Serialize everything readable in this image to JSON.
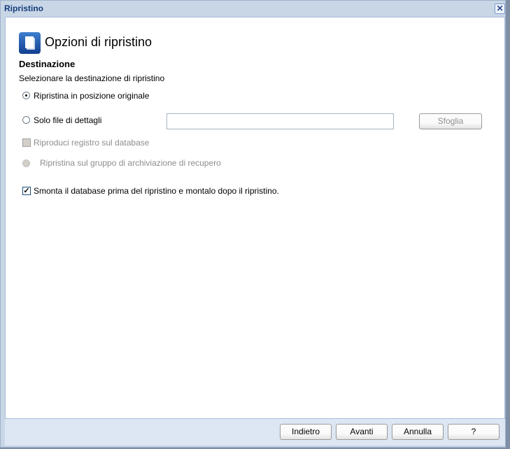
{
  "window": {
    "title": "Ripristino",
    "close_icon": "close-icon"
  },
  "header": {
    "title": "Opzioni di ripristino",
    "icon": "document-icon"
  },
  "section": {
    "heading": "Destinazione",
    "description": "Selezionare la destinazione di ripristino"
  },
  "options": {
    "original": {
      "label": "Ripristina in posizione originale",
      "selected": true
    },
    "files_only": {
      "label": "Solo file di dettagli",
      "selected": false,
      "path_value": "",
      "browse_label": "Sfoglia"
    },
    "replay_log": {
      "label": "Riproduci registro sul database",
      "checked": false,
      "disabled": true
    },
    "recovery_group": {
      "label": "Ripristina sul gruppo di archiviazione di recupero",
      "disabled": true
    },
    "dismount": {
      "label": "Smonta il database prima del ripristino e montalo dopo il ripristino.",
      "checked": true
    }
  },
  "footer": {
    "back": "Indietro",
    "next": "Avanti",
    "cancel": "Annulla",
    "help": "?"
  }
}
